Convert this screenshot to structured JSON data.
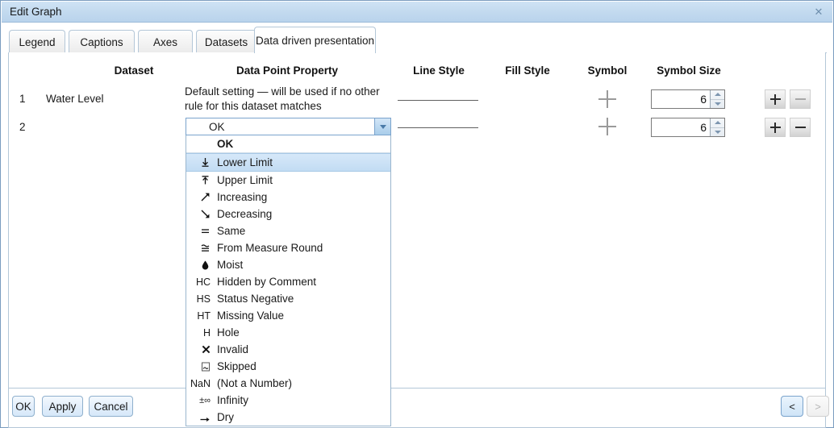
{
  "window": {
    "title": "Edit Graph",
    "close_label": "✕"
  },
  "tabs": [
    {
      "label": "Legend",
      "selected": false
    },
    {
      "label": "Captions",
      "selected": false
    },
    {
      "label": "Axes",
      "selected": false
    },
    {
      "label": "Datasets",
      "selected": false
    },
    {
      "label": "Data driven presentation",
      "selected": true
    }
  ],
  "table": {
    "headers": {
      "dataset": "Dataset",
      "data_point_property": "Data Point Property",
      "line_style": "Line Style",
      "fill_style": "Fill Style",
      "symbol": "Symbol",
      "symbol_size": "Symbol Size"
    },
    "rows": [
      {
        "num": "1",
        "dataset": "Water Level",
        "property_note": "Default setting — will be used if no other rule for this dataset matches",
        "symbol_size": "6",
        "add_label": "+",
        "remove_label": "−",
        "remove_enabled": false
      },
      {
        "num": "2",
        "dataset": "",
        "property_value": "OK",
        "symbol_size": "6",
        "add_label": "+",
        "remove_label": "−",
        "remove_enabled": true
      }
    ]
  },
  "dropdown": {
    "selected": "OK",
    "highlighted": "Lower Limit",
    "items": [
      {
        "icon": "none",
        "label": "OK",
        "header": true
      },
      {
        "icon": "lower-limit",
        "label": "Lower Limit"
      },
      {
        "icon": "upper-limit",
        "label": "Upper Limit"
      },
      {
        "icon": "increasing",
        "label": "Increasing"
      },
      {
        "icon": "decreasing",
        "label": "Decreasing"
      },
      {
        "icon": "same",
        "label": "Same"
      },
      {
        "icon": "from-measure",
        "label": "From Measure Round"
      },
      {
        "icon": "moist",
        "label": "Moist"
      },
      {
        "icon": "hc",
        "label": "Hidden by Comment"
      },
      {
        "icon": "hs",
        "label": "Status Negative"
      },
      {
        "icon": "ht",
        "label": "Missing Value"
      },
      {
        "icon": "h",
        "label": "Hole"
      },
      {
        "icon": "invalid",
        "label": "Invalid"
      },
      {
        "icon": "skipped",
        "label": "Skipped"
      },
      {
        "icon": "nan",
        "label": "(Not a Number)"
      },
      {
        "icon": "infinity",
        "label": "Infinity"
      },
      {
        "icon": "dry",
        "label": "Dry"
      }
    ]
  },
  "footer": {
    "ok": "OK",
    "apply": "Apply",
    "cancel": "Cancel",
    "prev": "<",
    "next": ">"
  }
}
